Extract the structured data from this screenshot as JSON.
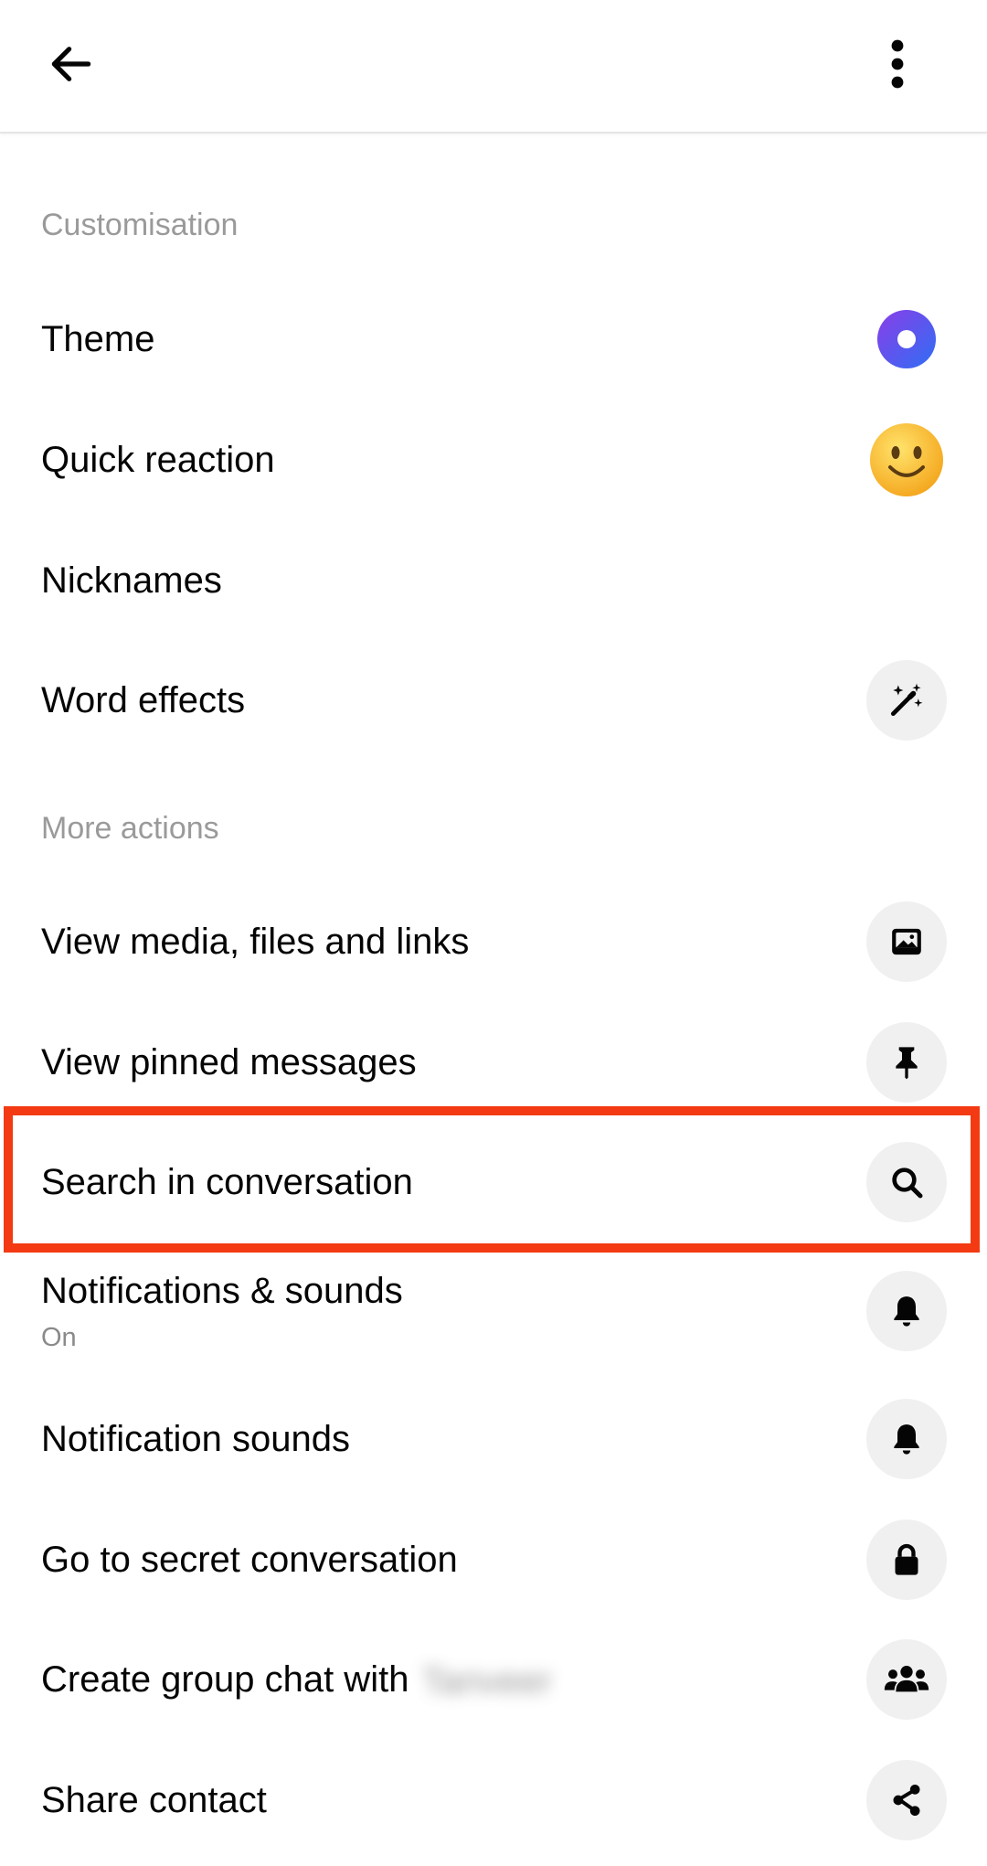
{
  "toolbar": {
    "back_icon": "arrow-left-icon",
    "more_icon": "vertical-dots-icon"
  },
  "sections": {
    "customisation": "Customisation",
    "more_actions": "More actions"
  },
  "items": {
    "theme": {
      "label": "Theme",
      "icon": "theme-circle-icon",
      "color_start": "#7b3fe4",
      "color_end": "#2b6ef2"
    },
    "quick_reaction": {
      "label": "Quick reaction",
      "icon": "smiley-emoji-icon",
      "emoji": "🙂"
    },
    "nicknames": {
      "label": "Nicknames"
    },
    "word_effects": {
      "label": "Word effects",
      "icon": "magic-wand-sparkles-icon"
    },
    "view_media": {
      "label": "View media, files and links",
      "icon": "image-icon"
    },
    "pinned": {
      "label": "View pinned messages",
      "icon": "pin-icon"
    },
    "search": {
      "label": "Search in conversation",
      "icon": "search-icon"
    },
    "notifications": {
      "label": "Notifications  & sounds",
      "sub": "On",
      "icon": "bell-icon"
    },
    "notification_sounds": {
      "label": "Notification sounds",
      "icon": "bell-icon"
    },
    "secret": {
      "label": "Go to secret conversation",
      "icon": "lock-icon"
    },
    "group_chat": {
      "label": "Create group chat with",
      "blurred_name": "Tanveer",
      "icon": "people-icon"
    },
    "share_contact": {
      "label": "Share contact",
      "icon": "share-icon"
    }
  },
  "highlight": {
    "target": "search",
    "color": "#f33a12"
  }
}
